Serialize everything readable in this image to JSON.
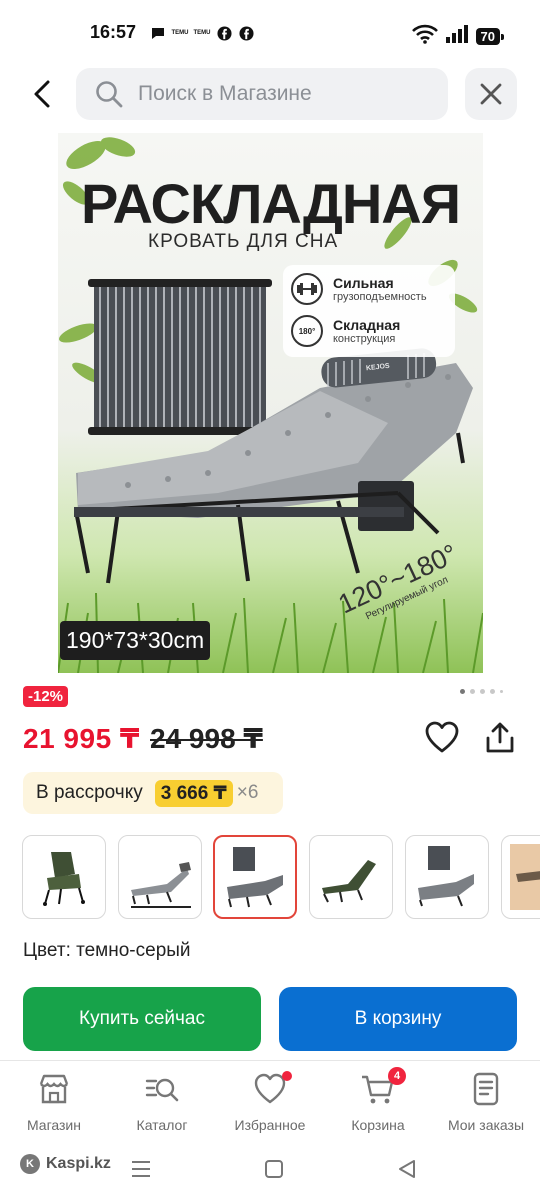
{
  "status_bar": {
    "time": "16:57",
    "notification_icons": [
      "chat-icon",
      "temu-icon",
      "temu-icon",
      "facebook-icon",
      "facebook-icon"
    ],
    "temu_label": "TEMU",
    "battery": "70"
  },
  "header": {
    "search_placeholder": "Поиск в Магазине"
  },
  "product_image": {
    "title": "РАСКЛАДНАЯ",
    "subtitle": "КРОВАТЬ ДЛЯ СНА",
    "features": [
      {
        "icon": "dumbbell-icon",
        "title": "Сильная",
        "subtitle": "грузоподъемность"
      },
      {
        "icon": "rotate-180-icon",
        "icon_text": "180°",
        "title": "Складная",
        "subtitle": "конструкция"
      }
    ],
    "dimensions": "190*73*30cm",
    "angle_text": "120°~180°",
    "angle_caption": "Регулируемый угол",
    "pillow_brand": "KEJOS"
  },
  "carousel": {
    "total_dots": 5,
    "active_index": 0
  },
  "pricing": {
    "discount": "-12%",
    "price": "21 995 ₸",
    "old_price": "24 998 ₸"
  },
  "installment": {
    "label": "В рассрочку",
    "amount": "3 666 ₸",
    "months": "×6"
  },
  "thumbnails": {
    "selected_index": 2,
    "items": [
      "chair-green",
      "bed-gray-side",
      "bed-gray-folded",
      "lounger-green",
      "bed-folded-2",
      "bed-tan"
    ]
  },
  "color": {
    "label": "Цвет: темно-серый"
  },
  "actions": {
    "buy_now": "Купить сейчас",
    "add_to_cart": "В корзину"
  },
  "bottom_nav": {
    "items": [
      {
        "label": "Магазин",
        "icon": "store-icon"
      },
      {
        "label": "Каталог",
        "icon": "catalog-search-icon"
      },
      {
        "label": "Избранное",
        "icon": "heart-icon",
        "has_dot": true
      },
      {
        "label": "Корзина",
        "icon": "cart-icon",
        "badge": "4"
      },
      {
        "label": "Мои заказы",
        "icon": "orders-icon"
      }
    ]
  },
  "system_bar": {
    "brand": "Kaspi.kz"
  },
  "colors": {
    "price_red": "#e8132f",
    "discount_red": "#f0243e",
    "buy_green": "#17a34a",
    "cart_blue": "#0a6fd1",
    "installment_bg": "#fdf5de",
    "installment_highlight": "#f8ce31"
  }
}
